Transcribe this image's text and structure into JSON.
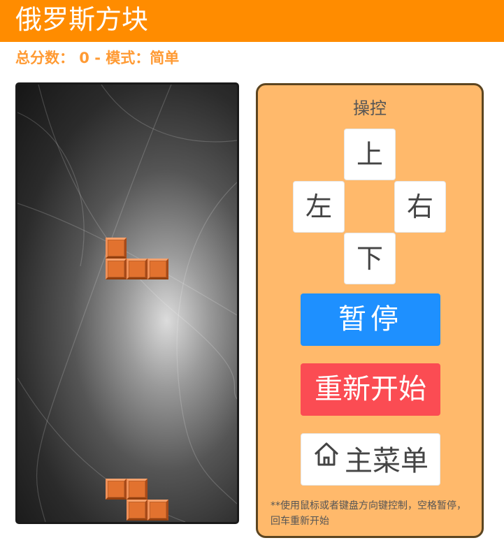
{
  "header": {
    "title": "俄罗斯方块"
  },
  "status": {
    "score_line": "总分数： 0 - 模式：简单",
    "score": 0,
    "mode": "简单"
  },
  "board": {
    "background": "gray-radial-curves",
    "block_color": "#e2722f",
    "active_piece": {
      "type": "J",
      "color": "orange"
    },
    "stacked_piece": {
      "type": "Z",
      "color": "orange"
    }
  },
  "controls": {
    "title": "操控",
    "up": "上",
    "left": "左",
    "right": "右",
    "down": "下",
    "pause": "暂停",
    "restart": "重新开始",
    "menu": "主菜单",
    "menu_icon": "home-icon",
    "hint": "**使用鼠标或者键盘方向键控制，空格暂停，回车重新开始"
  },
  "colors": {
    "header": "#ff8c00",
    "score_text": "#ff9a33",
    "panel": "#ffb96b",
    "panel_border": "#5c4520",
    "pause": "#1e90ff",
    "restart": "#fb4c53"
  }
}
